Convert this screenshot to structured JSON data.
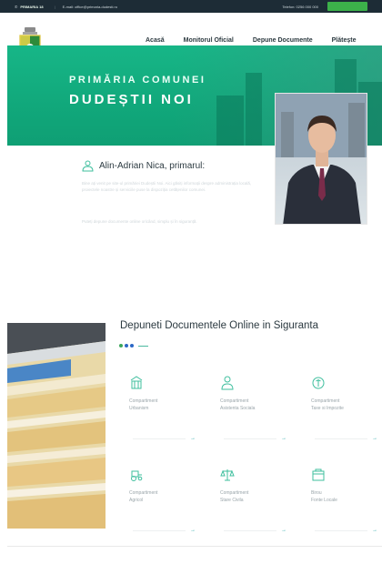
{
  "topbar": {
    "brand": "PRIMARIA 18",
    "email": "E-mail: office@primaria-dudesti.ro",
    "phone": "Telefon: 0256 000 000"
  },
  "nav": {
    "items": [
      "Acasă",
      "Monitorul Oficial",
      "Depune Documente",
      "Plătește"
    ]
  },
  "hero": {
    "title_line1": "PRIMĂRIA COMUNEI",
    "title_line2": "DUDEȘTII NOI"
  },
  "mayor": {
    "name": "Alin-Adrian Nica, primarul:",
    "bio_1": "Bine ați venit pe site-ul primăriei Dudeștii Noi. Aici găsiți informații despre administrația locală, proiectele noastre și serviciile puse la dispoziția cetățenilor comunei.",
    "bio_2": "Puteți depune documente online oricând, simplu și în siguranță."
  },
  "services": {
    "title": "Depuneti Documentele Online in Siguranta",
    "cards": [
      {
        "label": "Compartiment\nUrbanism",
        "icon": "building-icon"
      },
      {
        "label": "Compartiment\nAsistenta Sociala",
        "icon": "person-icon"
      },
      {
        "label": "Compartiment\nTaxe si Impozite",
        "icon": "coin-icon"
      },
      {
        "label": "Compartiment\nAgricol",
        "icon": "tractor-icon"
      },
      {
        "label": "Compartiment\nStare Civila",
        "icon": "scales-icon"
      },
      {
        "label": "Birou\nFonte Locale",
        "icon": "folder-icon"
      }
    ]
  },
  "colors": {
    "hero_green": "#17b687",
    "accent_green": "#3aa65a",
    "accent_blue": "#2b67c6",
    "topbar_dark": "#1d2c36"
  }
}
